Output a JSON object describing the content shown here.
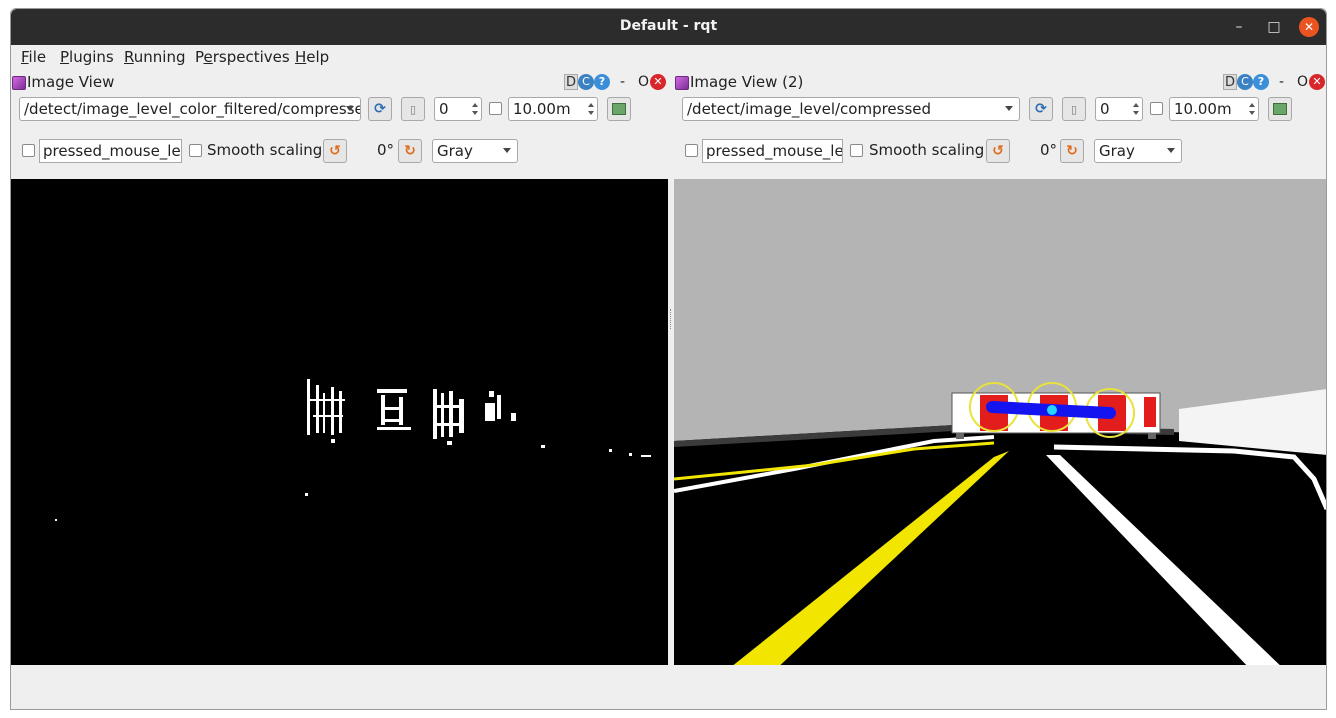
{
  "window": {
    "title": "Default - rqt",
    "minimize_glyph": "–",
    "maximize_glyph": "□",
    "close_glyph": "✕"
  },
  "menu": {
    "file": {
      "accel": "F",
      "rest": "ile"
    },
    "plugins": {
      "accel": "P",
      "rest": "lugins"
    },
    "running": {
      "accel": "R",
      "rest": "unning"
    },
    "perspectives": {
      "pre": "P",
      "accel": "e",
      "rest": "rspectives"
    },
    "help": {
      "accel": "H",
      "rest": "elp"
    }
  },
  "panels": [
    {
      "title": "Image View",
      "header_buttons": {
        "d": "D",
        "reload": "C",
        "help": "?",
        "minimize": "-",
        "float": "O",
        "close": "✕"
      },
      "topic": "/detect/image_level_color_filtered/compressed",
      "topic_visible": "/detect/image_level_color_filtered/compresse",
      "refresh_icon": "refresh-icon",
      "mouse_icon": "mouse-icon",
      "smoothing_value": "0",
      "timeout_value": "10.00m",
      "save_icon": "save-icon",
      "mouse_topic": "pressed_mouse_left",
      "smooth_label": "Smooth scaling",
      "rotate_left_glyph": "↺",
      "rotation": "0°",
      "rotate_right_glyph": "↻",
      "color_scheme": "Gray",
      "view_type": "binary-mask"
    },
    {
      "title": "Image View (2)",
      "header_buttons": {
        "d": "D",
        "reload": "C",
        "help": "?",
        "minimize": "-",
        "float": "O",
        "close": "✕"
      },
      "topic": "/detect/image_level/compressed",
      "topic_visible": "/detect/image_level/compressed",
      "refresh_icon": "refresh-icon",
      "mouse_icon": "mouse-icon",
      "smoothing_value": "0",
      "timeout_value": "10.00m",
      "save_icon": "save-icon",
      "mouse_topic": "pressed_mouse_left",
      "smooth_label": "Smooth scaling",
      "rotate_left_glyph": "↺",
      "rotation": "0°",
      "rotate_right_glyph": "↻",
      "color_scheme": "Gray",
      "view_type": "camera-road-scene"
    }
  ],
  "colors": {
    "titlebar": "#2c2c2c",
    "close_accent": "#e95420",
    "window_bg": "#efefef",
    "road_line_yellow": "#f2e600",
    "barrier_red": "#e31c1c",
    "detection_blue": "#1414f0",
    "detection_circle": "#e8e23a"
  }
}
